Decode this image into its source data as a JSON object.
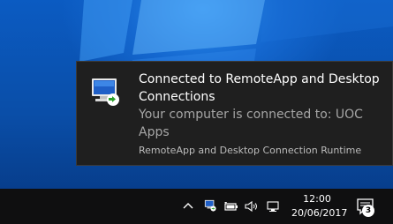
{
  "toast": {
    "title": "Connected to RemoteApp and Desktop Connections",
    "body": "Your computer is connected to: UOC Apps",
    "source": "RemoteApp and Desktop Connection Runtime",
    "icon": "remoteapp-connection-icon"
  },
  "taskbar": {
    "tray_icons": [
      "chevron-up-icon",
      "remoteapp-tray-icon",
      "battery-icon",
      "volume-icon",
      "network-icon"
    ],
    "clock_time": "12:00",
    "clock_date": "20/06/2017",
    "action_center_badge": "3"
  },
  "colors": {
    "toast_bg": "#1f1f1f",
    "taskbar_bg": "#0f0f10",
    "desktop_blue": "#0a5ec0"
  }
}
